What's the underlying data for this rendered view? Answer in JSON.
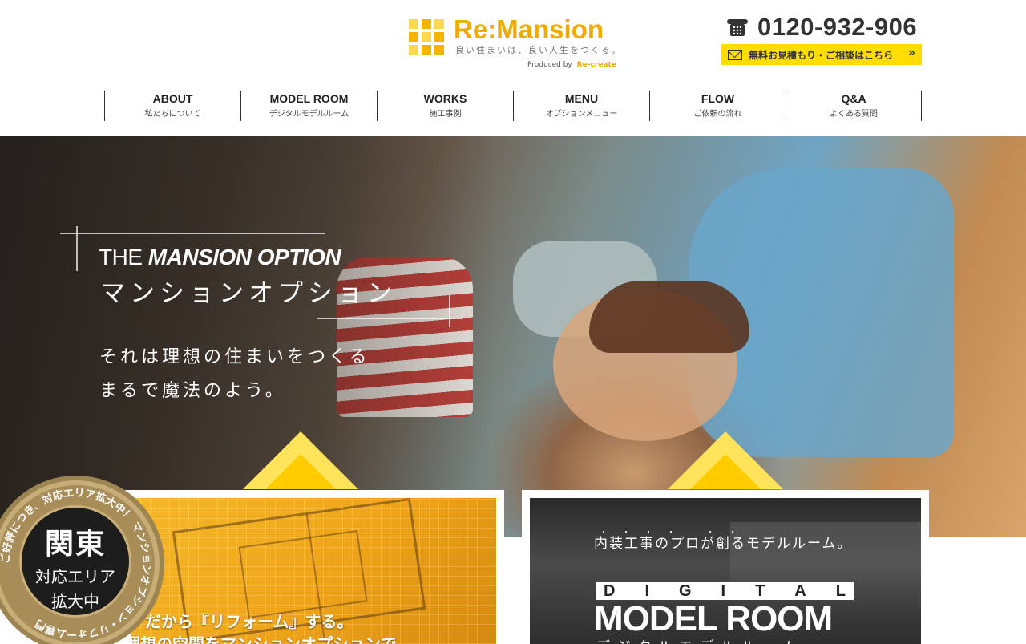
{
  "brand": {
    "name": "Re:Mansion",
    "tagline": "良い住まいは、良い人生をつくる。",
    "produced_by": "Produced by",
    "producer": "Re-create",
    "primary_color": "#f2a900",
    "accent_color": "#ffdd00"
  },
  "contact": {
    "phone": "0120-932-906",
    "phone_icon": "telephone-icon",
    "estimate_label": "無料お見積もり・ご相談はこちら",
    "estimate_icon": "mail-icon",
    "estimate_chevron": "»"
  },
  "nav": {
    "items": [
      {
        "en": "ABOUT",
        "ja": "私たちについて"
      },
      {
        "en": "MODEL ROOM",
        "ja": "デジタルモデルルーム"
      },
      {
        "en": "WORKS",
        "ja": "施工事例"
      },
      {
        "en": "MENU",
        "ja": "オプションメニュー"
      },
      {
        "en": "FLOW",
        "ja": "ご依頼の流れ"
      },
      {
        "en": "Q&A",
        "ja": "よくある質問"
      }
    ]
  },
  "hero": {
    "title_prefix": "THE",
    "title_bold": "MANSION OPTION",
    "title_ja": "マンションオプション",
    "lead_1": "それは理想の住まいをつくる",
    "lead_2": "まるで魔法のよう。"
  },
  "cards": {
    "reform": {
      "title": "だから『リフォーム』する。",
      "sub": "理想の空間をマンションオプションで"
    },
    "model_room": {
      "kicker": "内装工事のプロが創るモデルルーム。",
      "dots": "・・・・ ・・",
      "digital_letters": [
        "D",
        "I",
        "G",
        "I",
        "T",
        "A",
        "L"
      ],
      "title": "MODEL ROOM",
      "title_ja": "デジタルモデルルーム"
    }
  },
  "badge": {
    "ring_text": "ご好評につき、対応エリア拡大中！ マンションオプション・リフォーム専門",
    "line_1": "関東",
    "line_2": "対応エリア",
    "line_3": "拡大中"
  }
}
